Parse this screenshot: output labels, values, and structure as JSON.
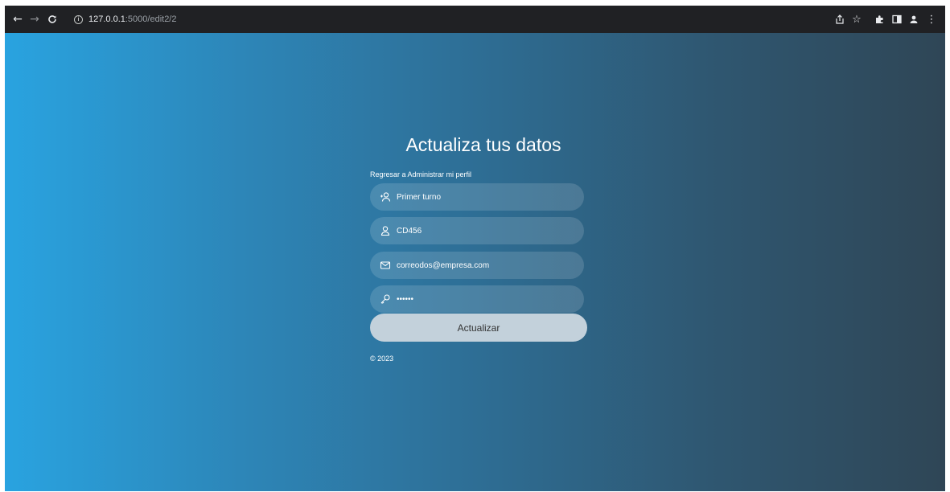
{
  "browser": {
    "url_host": "127.0.0.1",
    "url_path": ":5000/edit2/2",
    "nav": {
      "back": "back-icon",
      "forward": "forward-icon",
      "reload": "reload-icon"
    },
    "toolbar_icons": [
      "share-icon",
      "star-icon",
      "extensions-icon",
      "side-panel-icon",
      "profile-icon",
      "menu-icon"
    ]
  },
  "page": {
    "title": "Actualiza tus datos",
    "back_link": "Regresar a Administrar mi perfil",
    "fields": {
      "name": {
        "value": "Primer turno",
        "icon": "user-add-icon"
      },
      "code": {
        "value": "CD456",
        "icon": "user-icon"
      },
      "email": {
        "value": "correodos@empresa.com",
        "icon": "mail-icon"
      },
      "password": {
        "value": "••••••",
        "icon": "key-icon"
      }
    },
    "submit_label": "Actualizar",
    "footer": "© 2023",
    "colors": {
      "gradient_start": "#29a3e0",
      "gradient_end": "#2f4656",
      "button": "#c3d1db"
    }
  }
}
